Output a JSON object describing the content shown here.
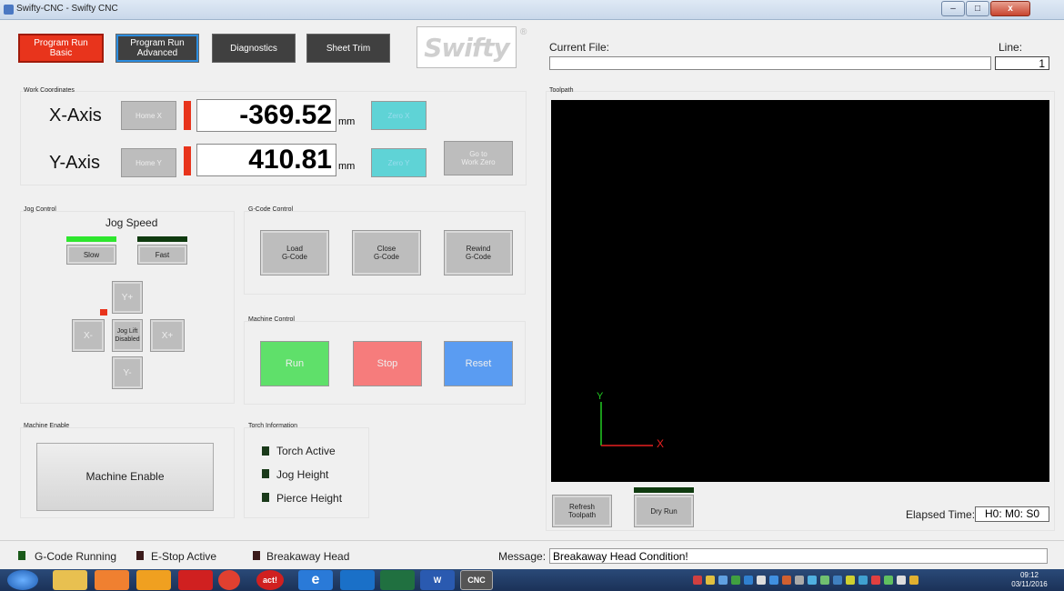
{
  "window": {
    "title": "Swifty-CNC - Swifty CNC",
    "minimize": "–",
    "maximize": "□",
    "close": "x"
  },
  "top_buttons": {
    "program_run_basic": "Program Run\nBasic",
    "program_run_advanced": "Program Run\nAdvanced",
    "diagnostics": "Diagnostics",
    "sheet_trim": "Sheet Trim"
  },
  "logo": {
    "text": "Swifty",
    "reg": "®"
  },
  "current_file": {
    "label": "Current File:",
    "value": ""
  },
  "line": {
    "label": "Line:",
    "value": "1"
  },
  "work_coordinates": {
    "title": "Work Coordinates",
    "x": {
      "label": "X-Axis",
      "home": "Home X",
      "value": "-369.52",
      "unit": "mm",
      "zero": "Zero X"
    },
    "y": {
      "label": "Y-Axis",
      "home": "Home Y",
      "value": "410.81",
      "unit": "mm",
      "zero": "Zero Y"
    },
    "go_to_work_zero": "Go to\nWork Zero"
  },
  "jog_control": {
    "title": "Jog Control",
    "speed_label": "Jog Speed",
    "slow": "Slow",
    "fast": "Fast",
    "y_plus": "Y+",
    "y_minus": "Y-",
    "x_plus": "X+",
    "x_minus": "X-",
    "jog_lift": "Jog Lift\nDisabled",
    "colors": {
      "slow_indicator": "#2ee62e",
      "fast_indicator": "#0f3a0f",
      "lift_indicator": "#e8341c"
    }
  },
  "gcode_control": {
    "title": "G-Code Control",
    "load": "Load\nG-Code",
    "close": "Close\nG-Code",
    "rewind": "Rewind\nG-Code"
  },
  "machine_control": {
    "title": "Machine Control",
    "run": "Run",
    "stop": "Stop",
    "reset": "Reset",
    "colors": {
      "run": "#5fe06a",
      "stop": "#f67c7c",
      "reset": "#5a9cf2"
    }
  },
  "machine_enable": {
    "title": "Machine Enable",
    "button": "Machine Enable"
  },
  "torch_information": {
    "title": "Torch Information",
    "items": [
      "Torch Active",
      "Jog Height",
      "Pierce Height"
    ]
  },
  "toolpath": {
    "title": "Toolpath",
    "axis_y": "Y",
    "axis_x": "X",
    "refresh": "Refresh\nToolpath",
    "dry_run": "Dry Run",
    "elapsed_label": "Elapsed Time:",
    "elapsed_value": "H0: M0: S0"
  },
  "status": {
    "gcode_running": "G-Code Running",
    "estop_active": "E-Stop Active",
    "breakaway_head": "Breakaway Head",
    "message_label": "Message:",
    "message_value": "Breakaway Head Condition!"
  },
  "taskbar": {
    "act": "act!",
    "cnc": "CNC",
    "word": "W",
    "time": "09:12",
    "date": "03/11/2016"
  }
}
